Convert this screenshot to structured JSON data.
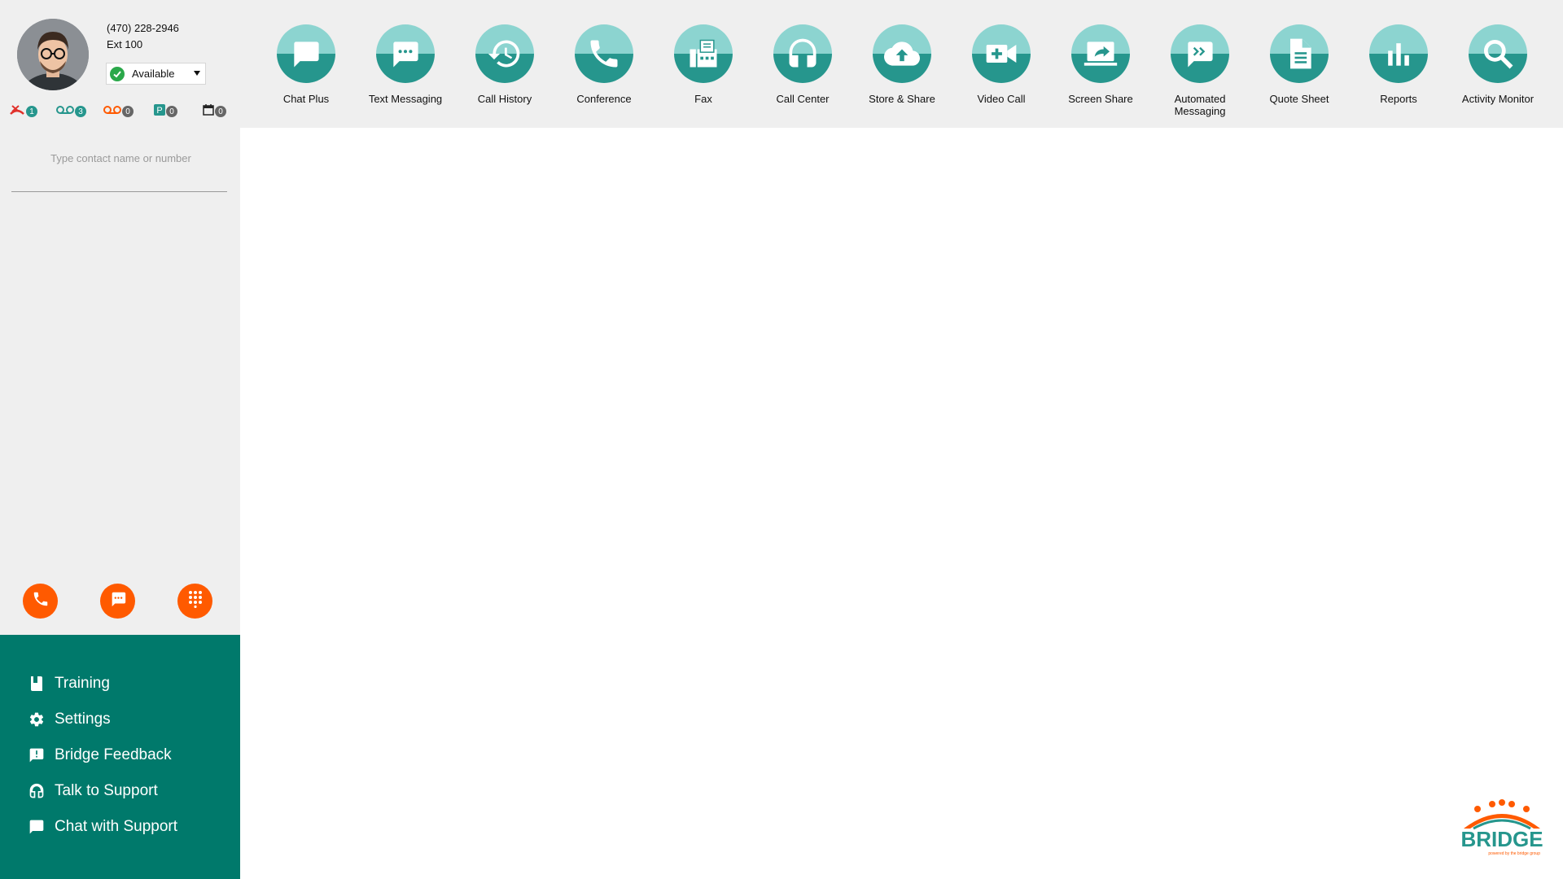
{
  "profile": {
    "phone_number": "(470) 228-2946",
    "extension": "Ext 100",
    "status": "Available",
    "status_color": "#2aa84a"
  },
  "counters": [
    {
      "icon": "missed-call-icon",
      "count": "1",
      "color": "#e0312b"
    },
    {
      "icon": "voicemail-icon",
      "count": "3",
      "color": "#26968d"
    },
    {
      "icon": "voicemail-orange-icon",
      "count": "0",
      "color": "#ff5a00"
    },
    {
      "icon": "parking-icon",
      "count": "0",
      "color": "#26968d"
    },
    {
      "icon": "calendar-icon",
      "count": "0",
      "color": "#222222"
    }
  ],
  "search": {
    "placeholder": "Type contact name or number"
  },
  "actions": [
    {
      "icon": "phone-icon",
      "name": "call"
    },
    {
      "icon": "chat-icon",
      "name": "message"
    },
    {
      "icon": "dialpad-icon",
      "name": "dialpad"
    }
  ],
  "menu": {
    "items": [
      {
        "label": "Training",
        "icon": "book-icon"
      },
      {
        "label": "Settings",
        "icon": "gear-icon"
      },
      {
        "label": "Bridge Feedback",
        "icon": "feedback-icon"
      },
      {
        "label": "Talk to Support",
        "icon": "headset-icon"
      },
      {
        "label": "Chat with Support",
        "icon": "chat-bubble-icon"
      }
    ]
  },
  "toolbar": {
    "items": [
      {
        "label": "Chat Plus",
        "icon": "chat-bubble-icon"
      },
      {
        "label": "Text Messaging",
        "icon": "sms-icon"
      },
      {
        "label": "Call History",
        "icon": "history-icon"
      },
      {
        "label": "Conference",
        "icon": "phone-icon"
      },
      {
        "label": "Fax",
        "icon": "fax-icon"
      },
      {
        "label": "Call Center",
        "icon": "headset-icon"
      },
      {
        "label": "Store & Share",
        "icon": "cloud-upload-icon"
      },
      {
        "label": "Video Call",
        "icon": "video-call-icon"
      },
      {
        "label": "Screen Share",
        "icon": "screen-share-icon"
      },
      {
        "label": "Automated Messaging",
        "icon": "automated-message-icon"
      },
      {
        "label": "Quote Sheet",
        "icon": "document-icon"
      },
      {
        "label": "Reports",
        "icon": "bar-chart-icon"
      },
      {
        "label": "Activity Monitor",
        "icon": "search-icon"
      }
    ]
  },
  "logo": {
    "text": "BRIDGE",
    "tagline": "powered by the bridge group"
  },
  "colors": {
    "accent": "#26968d",
    "accent_light": "#8cd4d0",
    "menu_bg": "#00796b",
    "action": "#ff5a00"
  }
}
